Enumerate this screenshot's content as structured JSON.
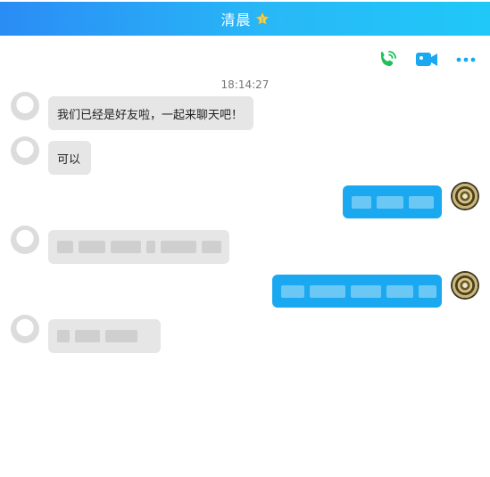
{
  "header": {
    "title": "清晨",
    "star_icon": "star-icon"
  },
  "actions": {
    "call_icon": "phone-icon",
    "video_icon": "video-camera-icon",
    "more_icon": "more-dots-icon"
  },
  "timestamp": "18:14:27",
  "messages": [
    {
      "side": "in",
      "text": "我们已经是好友啦，一起来聊天吧！"
    },
    {
      "side": "in",
      "text": "可以"
    },
    {
      "side": "out",
      "text": ""
    },
    {
      "side": "in",
      "text": ""
    },
    {
      "side": "out",
      "text": ""
    },
    {
      "side": "in",
      "text": ""
    }
  ],
  "colors": {
    "header_start": "#2a8cf5",
    "header_end": "#20c8f8",
    "out_bubble": "#1aa9f0",
    "in_bubble": "#e6e6e6",
    "icon_green": "#22c05a",
    "icon_blue": "#1aa9f0"
  }
}
